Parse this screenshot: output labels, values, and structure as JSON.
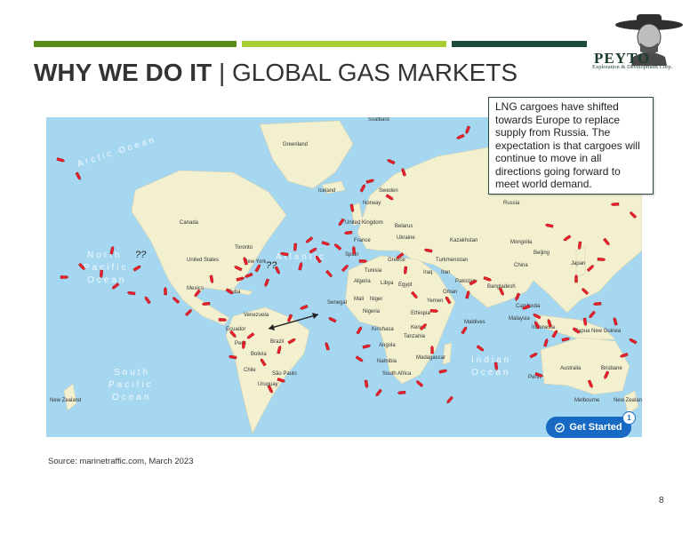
{
  "header": {
    "title_bold": "WHY WE DO IT",
    "title_separator": "|",
    "title_rest": "GLOBAL GAS MARKETS",
    "bar_colors": [
      "#5a8a1a",
      "#a8cd32",
      "#1f4a3e"
    ]
  },
  "logo": {
    "name": "PEYTO",
    "subtitle": "Exploration & Development Corp."
  },
  "callout": {
    "text": "LNG cargoes have shifted towards Europe to replace supply from Russia. The expectation is that cargoes will continue to move in all directions going forward to meet world demand."
  },
  "map": {
    "ocean_color": "#a6d7f0",
    "land_color": "#f3f0d0",
    "ship_color": "#e8202a",
    "question_mark": "??",
    "ocean_labels": {
      "arctic": "Arctic Ocean",
      "north_pacific": [
        "North",
        "Pacific",
        "Ocean"
      ],
      "south_pacific": [
        "South",
        "Pacific",
        "Ocean"
      ],
      "north_atlantic": "Atlantic",
      "indian": [
        "Indian",
        "Ocean"
      ]
    },
    "places": [
      "Svalbard",
      "Greenland",
      "Iceland",
      "Sweden",
      "Norway",
      "United Kingdom",
      "France",
      "Spain",
      "Belarus",
      "Ukraine",
      "Greece",
      "Tunisia",
      "Algeria",
      "Libya",
      "Egypt",
      "Mali",
      "Niger",
      "Senegal",
      "Nigeria",
      "Ethiopia",
      "Kenya",
      "Tanzania",
      "Kinshasa",
      "Angola",
      "Namibia",
      "Madagascar",
      "South Africa",
      "Kazakhstan",
      "Turkmenistan",
      "Iran",
      "Iraq",
      "Pakistan",
      "Oman",
      "Yemen",
      "Bangladesh",
      "Mongolia",
      "China",
      "Beijing",
      "Japan",
      "Cambodia",
      "Malaysia",
      "Indonesia",
      "Papua New Guinea",
      "Australia",
      "Brisbane",
      "Perth",
      "Melbourne",
      "New Zealand",
      "Canada",
      "United States",
      "Toronto",
      "New York",
      "Mexico",
      "Cuba",
      "Venezuela",
      "Ecuador",
      "Peru",
      "Brazil",
      "Bolivia",
      "Chile",
      "São Paulo",
      "Uruguay",
      "Maldives",
      "Russia"
    ]
  },
  "get_started": {
    "label": "Get Started",
    "badge": "1"
  },
  "footer": {
    "source": "Source: marinetraffic.com, March 2023",
    "page_number": "8"
  }
}
